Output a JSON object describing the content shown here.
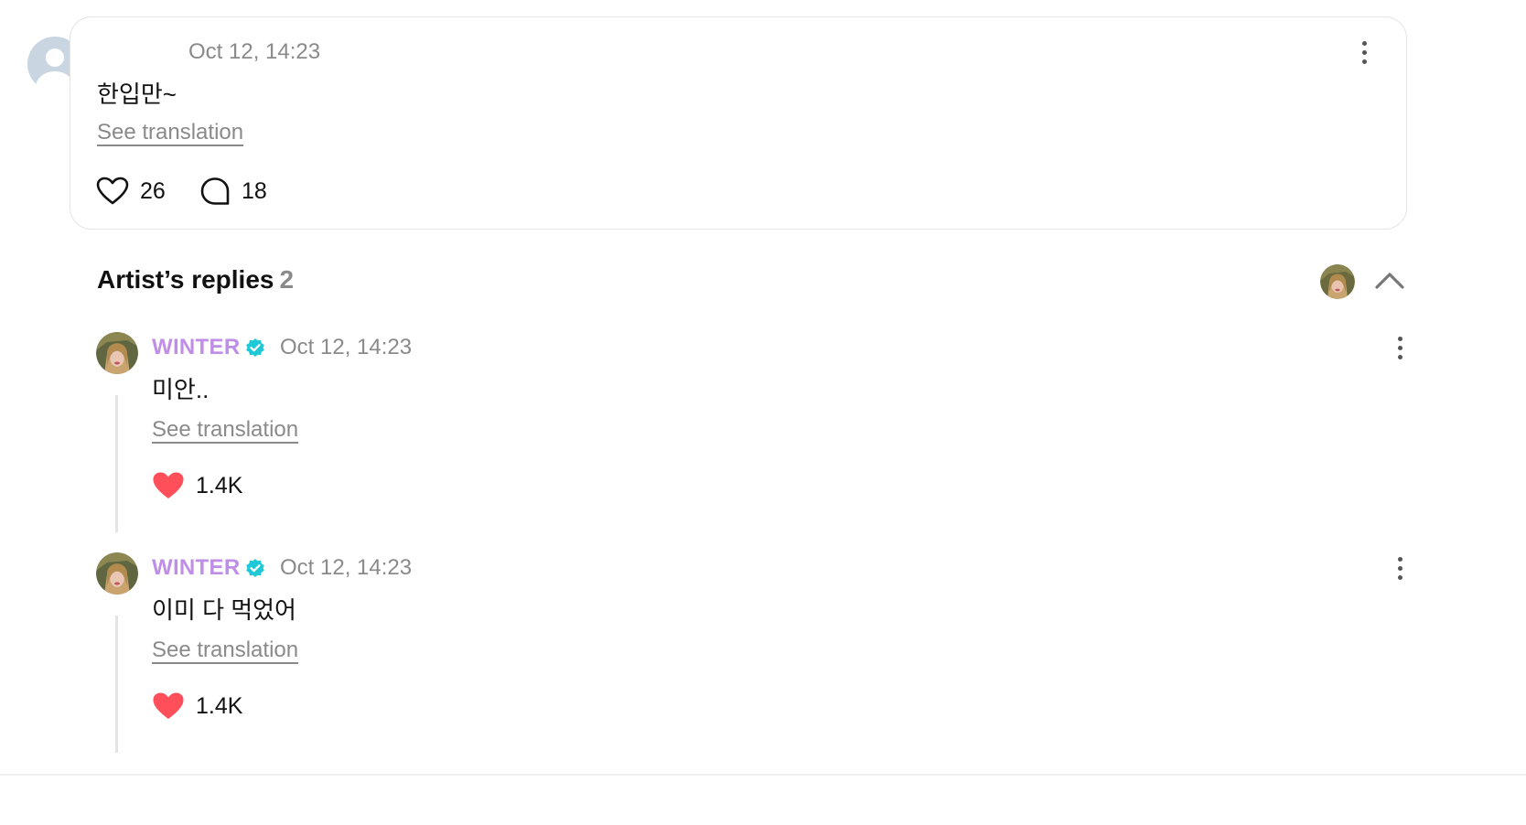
{
  "comment": {
    "timestamp": "Oct 12, 14:23",
    "text": "한입만~",
    "see_translation": "See translation",
    "likes": "26",
    "replies": "18",
    "icons": {
      "like": "heart-outline-icon",
      "reply": "speech-bubble-icon",
      "more": "more-vertical-icon"
    }
  },
  "artist_replies": {
    "title": "Artist’s replies",
    "count": "2",
    "items": [
      {
        "author": "WINTER",
        "timestamp": "Oct 12, 14:23",
        "text": "미안..",
        "see_translation": "See translation",
        "likes": "1.4K"
      },
      {
        "author": "WINTER",
        "timestamp": "Oct 12, 14:23",
        "text": "이미 다 먹었어",
        "see_translation": "See translation",
        "likes": "1.4K"
      }
    ]
  },
  "colors": {
    "artist_name": "#c08ee6",
    "verified_badge": "#1fc8d6",
    "heart_filled": "#ff4f5a",
    "muted_text": "#8a8a8a"
  }
}
